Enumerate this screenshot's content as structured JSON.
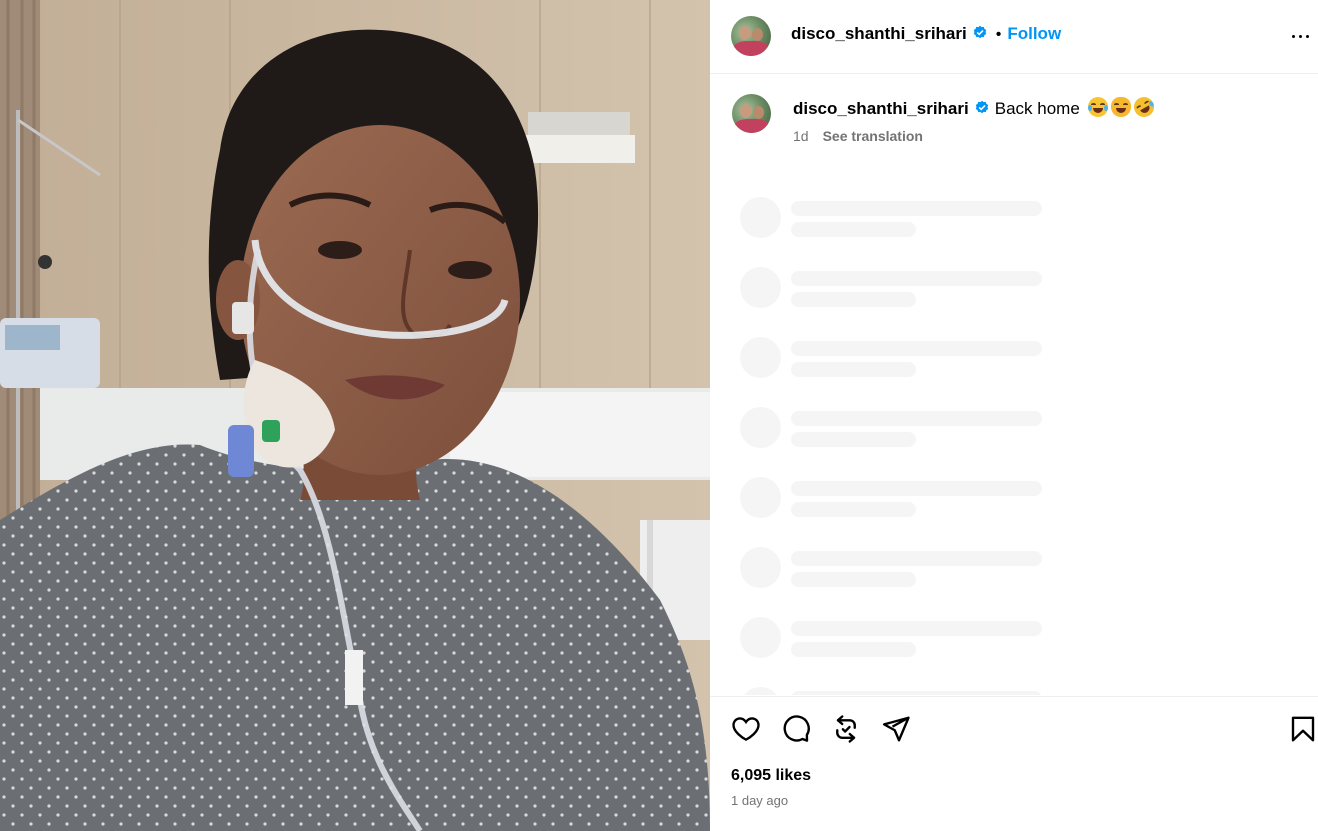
{
  "post": {
    "image": {
      "description": "hospital-selfie-photo"
    }
  },
  "header": {
    "username": "disco_shanthi_srihari",
    "separator": "•",
    "follow_label": "Follow"
  },
  "caption": {
    "username": "disco_shanthi_srihari",
    "text": "Back home",
    "emojis": [
      "joy-emoji",
      "cat-emoji",
      "rofl-emoji"
    ],
    "time_short": "1d",
    "translation_label": "See translation"
  },
  "comments_loading": {
    "rows": 8
  },
  "actions": {
    "icons": [
      "heart-icon",
      "comment-icon",
      "repost-icon",
      "share-icon",
      "bookmark-icon"
    ],
    "likes": "6,095 likes",
    "date": "1 day ago"
  },
  "colors": {
    "accent": "#0095f6",
    "verified": "#0095f6",
    "muted_text": "#737373",
    "skeleton": "#f5f5f5",
    "divider": "#efefef"
  }
}
